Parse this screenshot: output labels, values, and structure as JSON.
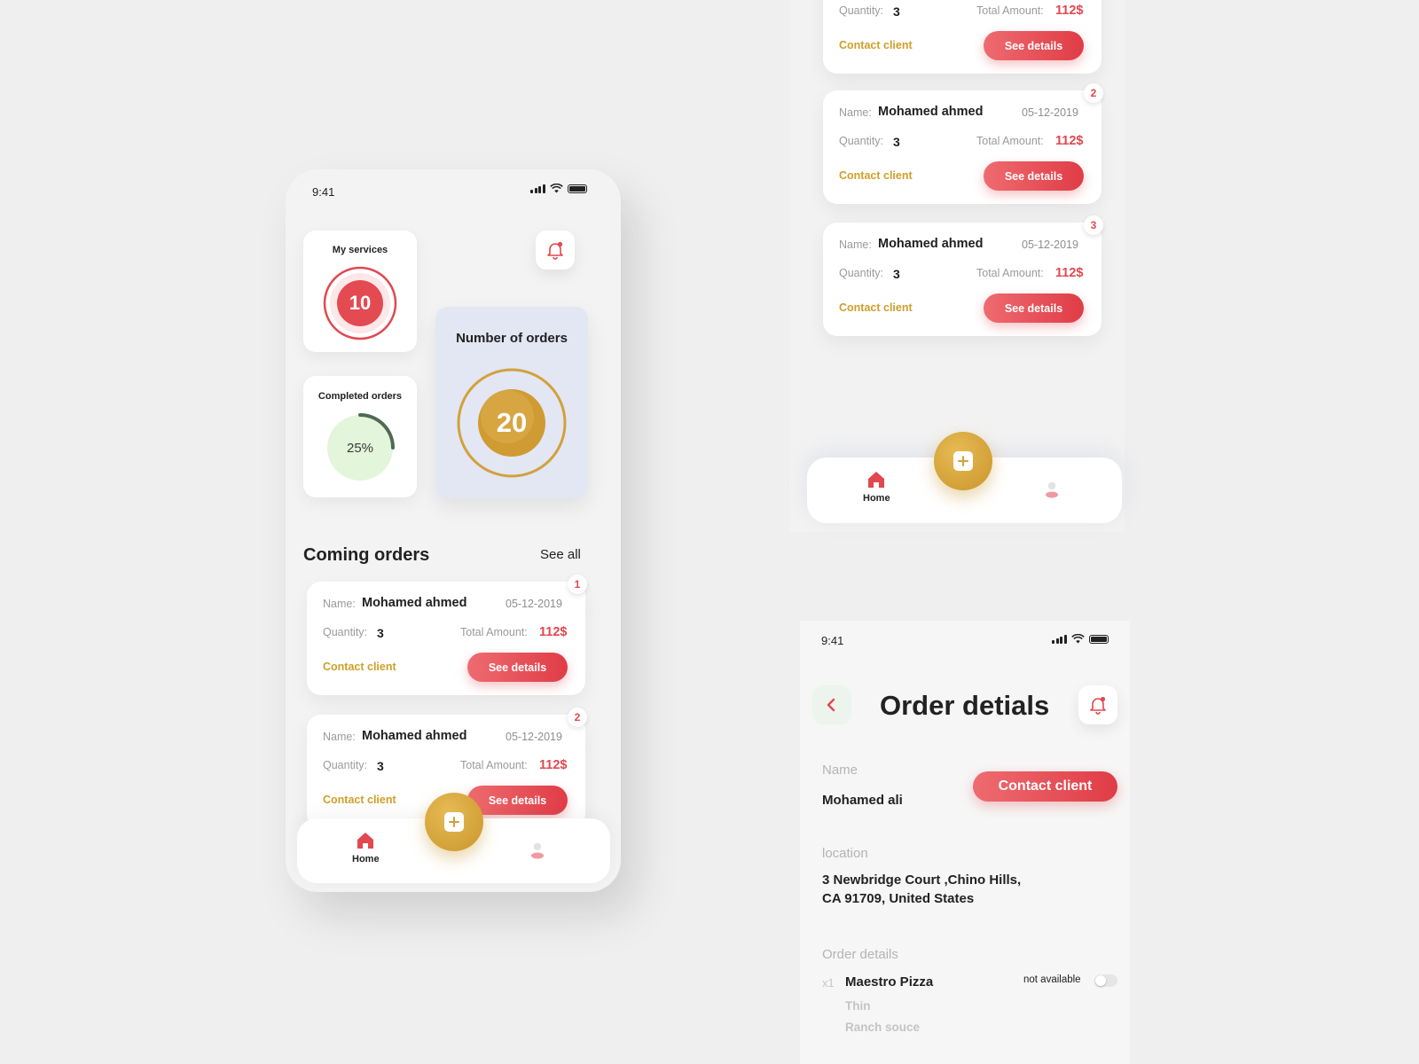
{
  "colors": {
    "accent_red": "#e1484f",
    "accent_gold": "#cf9f2a",
    "background": "#efefef",
    "orders_card": "#e3e6f3",
    "completed_ring": "#4f6a52"
  },
  "status_bar": {
    "time": "9:41"
  },
  "dashboard": {
    "my_services": {
      "title": "My services",
      "value": "10"
    },
    "completed_orders": {
      "title": "Completed orders",
      "percent_label": "25%",
      "progress": 0.25
    },
    "number_of_orders": {
      "title": "Number of orders",
      "value": "20"
    },
    "notification_icon": "bell-icon"
  },
  "coming_orders": {
    "title": "Coming orders",
    "see_all": "See all",
    "name_label": "Name:",
    "quantity_label": "Quantity:",
    "total_label": "Total Amount:",
    "contact_label": "Contact client",
    "details_label": "See details",
    "items": [
      {
        "index": "1",
        "name": "Mohamed ahmed",
        "date": "05-12-2019",
        "quantity": "3",
        "amount": "112$"
      },
      {
        "index": "2",
        "name": "Mohamed ahmed",
        "date": "05-12-2019",
        "quantity": "3",
        "amount": "112$"
      }
    ]
  },
  "scrolled_orders": {
    "items": [
      {
        "index": "",
        "name": "",
        "date": "",
        "quantity": "3",
        "amount": "112$"
      },
      {
        "index": "2",
        "name": "Mohamed ahmed",
        "date": "05-12-2019",
        "quantity": "3",
        "amount": "112$"
      },
      {
        "index": "3",
        "name": "Mohamed ahmed",
        "date": "05-12-2019",
        "quantity": "3",
        "amount": "112$"
      }
    ]
  },
  "bottom_nav": {
    "home_label": "Home",
    "home_icon": "home-icon",
    "profile_icon": "user-icon",
    "add_icon": "plus-icon"
  },
  "order_details": {
    "title": "Order detials",
    "name_label": "Name",
    "name_value": "Mohamed ali",
    "contact_button": "Contact client",
    "location_label": "location",
    "location_line1": "3 Newbridge Court ,Chino Hills,",
    "location_line2": "CA 91709, United States",
    "details_label": "Order details",
    "item_qty": "x1",
    "item_name": "Maestro Pizza",
    "item_status": "not available",
    "item_option1": "Thin",
    "item_option2": "Ranch souce"
  }
}
